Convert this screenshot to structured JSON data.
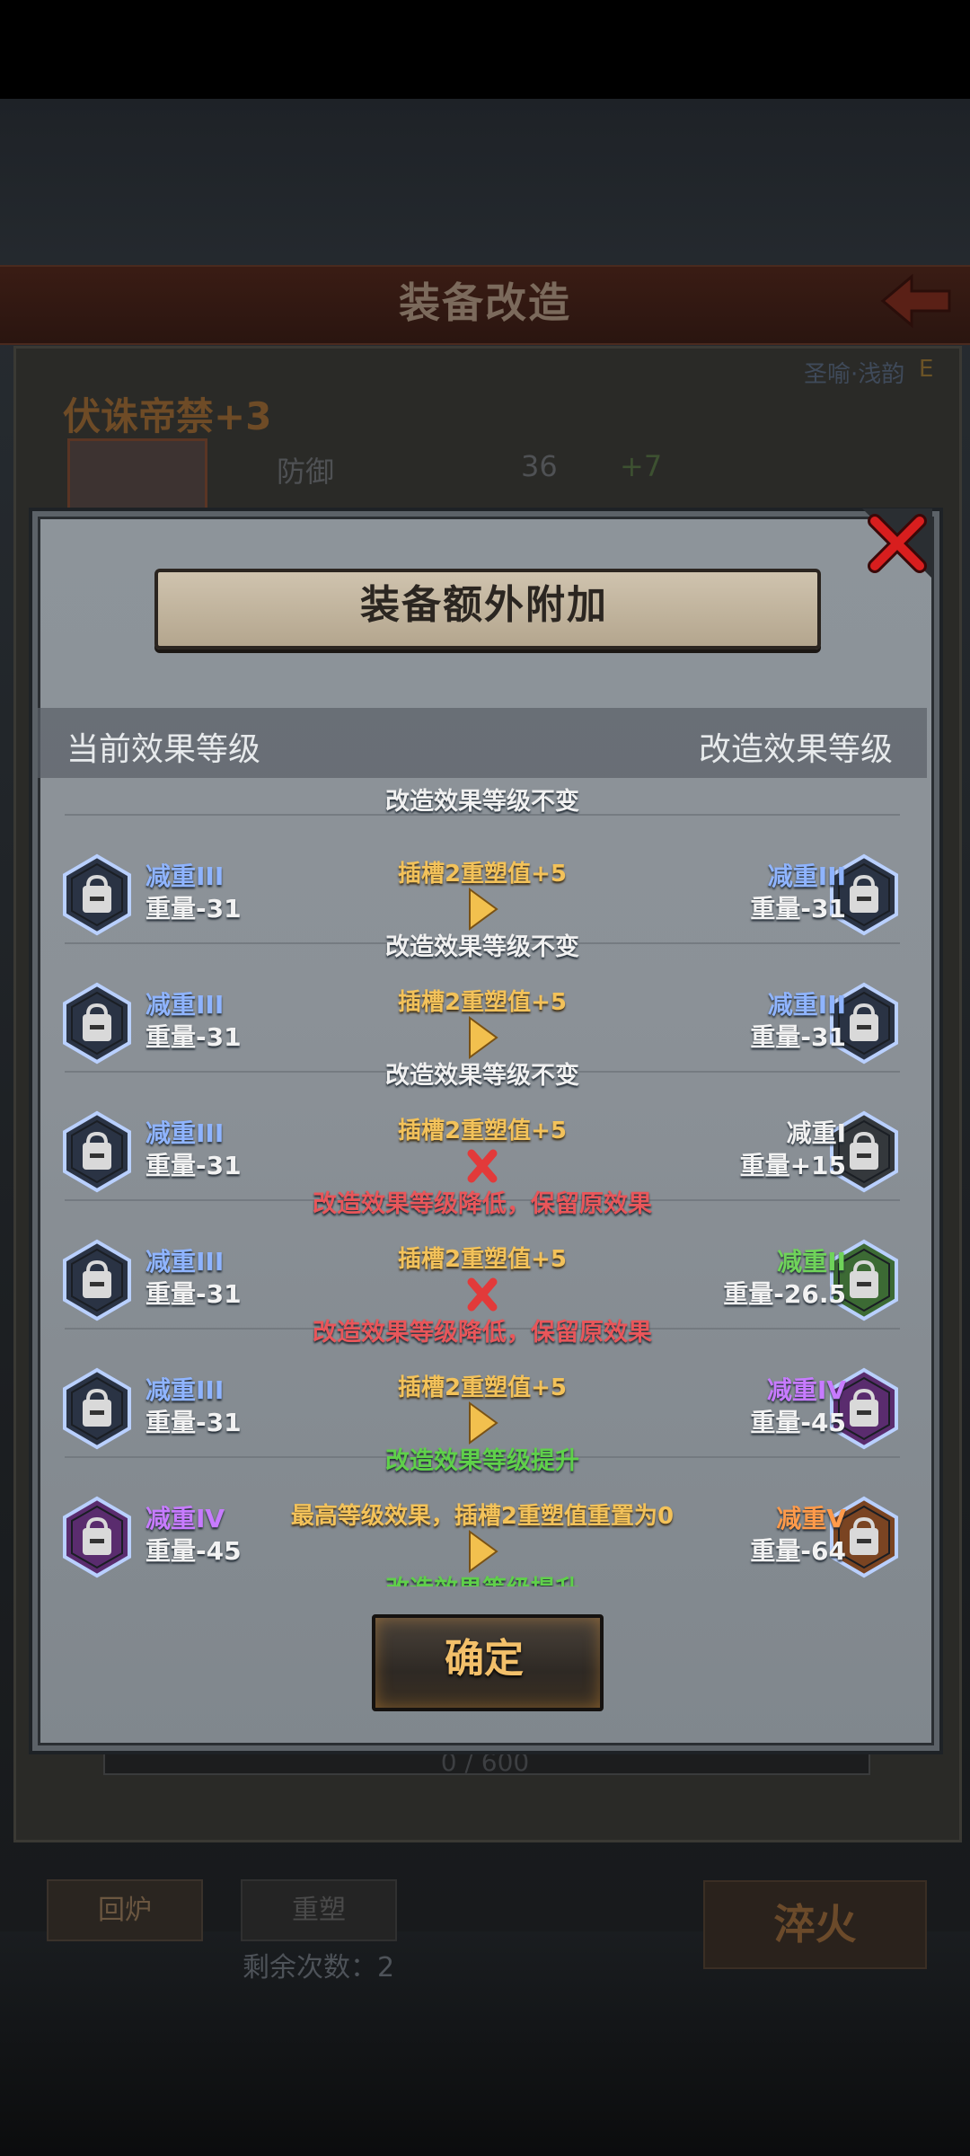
{
  "screen": {
    "title": "装备改造",
    "equipment_name": "伏诛帝禁+3",
    "tag": "圣喻·浅韵",
    "tag_grade": "E",
    "stat_label": "防御",
    "stat_value": "36",
    "stat_bonus": "+7",
    "progress_text": "0 / 600",
    "progress": 0,
    "btn_recycle": "回炉",
    "btn_reshape": "重塑",
    "remaining": "剩余次数：2",
    "btn_quench": "淬火"
  },
  "dialog": {
    "title": "装备额外附加",
    "header_left": "当前效果等级",
    "header_right": "改造效果等级",
    "partial_row_text": "改造效果等级不变",
    "confirm_label": "确定",
    "rows": [
      {
        "left_name": "减重III",
        "left_value": "重量-31",
        "left_color": "#2a3344",
        "center_top": "插槽2重塑值+5",
        "icon": "arrow",
        "right_name": "减重III",
        "right_value": "重量-31",
        "right_color": "#2a3344",
        "right_name_color": "#8fb4ff",
        "center_bottom": "改造效果等级不变",
        "bottom_color": "#f0f0f0"
      },
      {
        "left_name": "减重III",
        "left_value": "重量-31",
        "left_color": "#2a3344",
        "center_top": "插槽2重塑值+5",
        "icon": "arrow",
        "right_name": "减重III",
        "right_value": "重量-31",
        "right_color": "#2a3344",
        "right_name_color": "#8fb4ff",
        "center_bottom": "改造效果等级不变",
        "bottom_color": "#f0f0f0"
      },
      {
        "left_name": "减重III",
        "left_value": "重量-31",
        "left_color": "#2a3344",
        "center_top": "插槽2重塑值+5",
        "icon": "cross",
        "right_name": "减重I",
        "right_value": "重量+15",
        "right_color": "#34383c",
        "right_name_color": "#f0f0f0",
        "center_bottom": "改造效果等级降低，保留原效果",
        "bottom_color": "#e8565a"
      },
      {
        "left_name": "减重III",
        "left_value": "重量-31",
        "left_color": "#2a3344",
        "center_top": "插槽2重塑值+5",
        "icon": "cross",
        "right_name": "减重II",
        "right_value": "重量-26.5",
        "right_color": "#3c6a34",
        "right_name_color": "#6fd35a",
        "center_bottom": "改造效果等级降低，保留原效果",
        "bottom_color": "#e8565a"
      },
      {
        "left_name": "减重III",
        "left_value": "重量-31",
        "left_color": "#2a3344",
        "center_top": "插槽2重塑值+5",
        "icon": "arrow",
        "right_name": "减重IV",
        "right_value": "重量-45",
        "right_color": "#5a2c6e",
        "right_name_color": "#c77bff",
        "center_bottom": "改造效果等级提升",
        "bottom_color": "#5fd04a"
      },
      {
        "left_name": "减重IV",
        "left_value": "重量-45",
        "left_color": "#5a2c6e",
        "left_name_color": "#c77bff",
        "center_top": "最高等级效果，插槽2重塑值重置为0",
        "icon": "arrow",
        "right_name": "减重V",
        "right_value": "重量-64",
        "right_color": "#7a4422",
        "right_name_color": "#ff9a4a",
        "center_bottom": "改造效果等级提升",
        "bottom_color": "#5fd04a"
      }
    ]
  }
}
